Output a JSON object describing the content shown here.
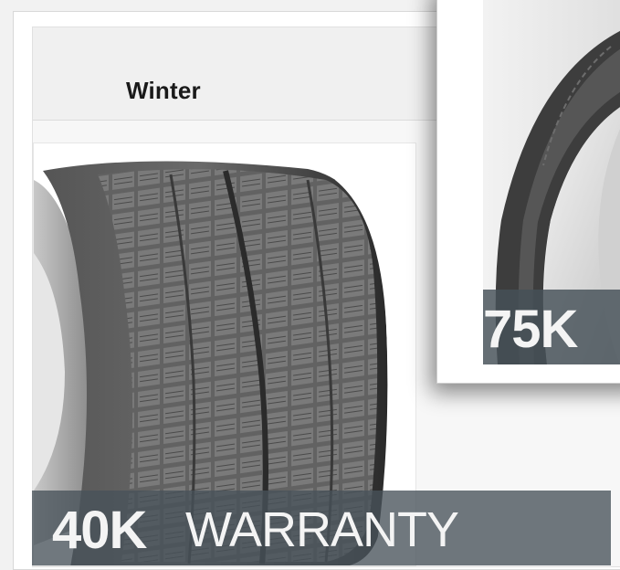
{
  "back_card": {
    "category_title": "Winter",
    "warranty_amount": "40K",
    "warranty_word": "WARRANTY"
  },
  "front_card": {
    "warranty_amount": "75K"
  },
  "colors": {
    "warranty_bar": "#48525a",
    "page_background": "#f2f2f2"
  }
}
